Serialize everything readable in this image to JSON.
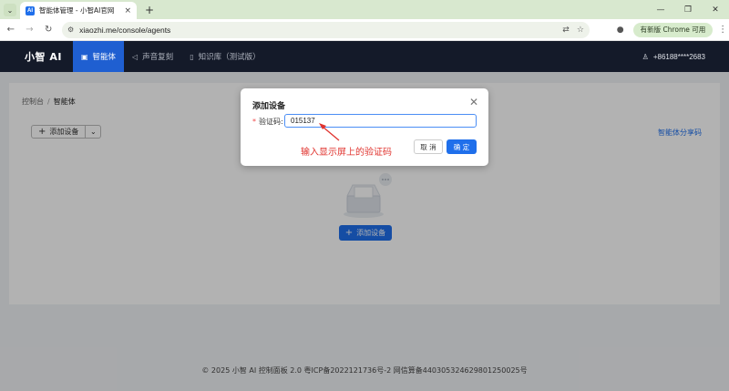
{
  "browser": {
    "tab_title": "智能体管理 - 小智AI官网",
    "favicon_text": "AI",
    "url": "xiaozhi.me/console/agents",
    "update_button": "有新版 Chrome 可用"
  },
  "header": {
    "brand": "小智 AI",
    "nav": [
      {
        "label": "智能体",
        "icon": "agent-icon",
        "active": true
      },
      {
        "label": "声音复刻",
        "icon": "speaker-icon",
        "active": false
      },
      {
        "label": "知识库（测试版）",
        "icon": "book-icon",
        "active": false
      }
    ],
    "user": "+86188****2683"
  },
  "page": {
    "breadcrumb": [
      "控制台",
      "智能体"
    ],
    "breadcrumb_sep": "/",
    "add_device": "添加设备",
    "share_link": "智能体分享码",
    "empty_add": "添加设备",
    "footer": "© 2025 小智 AI 控制面板 2.0 粤ICP备2022121736号-2 网信算备440305324629801250025号"
  },
  "modal": {
    "title": "添加设备",
    "field_label": "验证码:",
    "code_value": "015137",
    "hint": "输入显示屏上的验证码",
    "cancel": "取 消",
    "confirm": "确 定"
  },
  "colors": {
    "primary": "#1f6feb",
    "header_bg": "#141a29",
    "hint_red": "#e0332e",
    "tabstrip": "#d8e8cf"
  }
}
